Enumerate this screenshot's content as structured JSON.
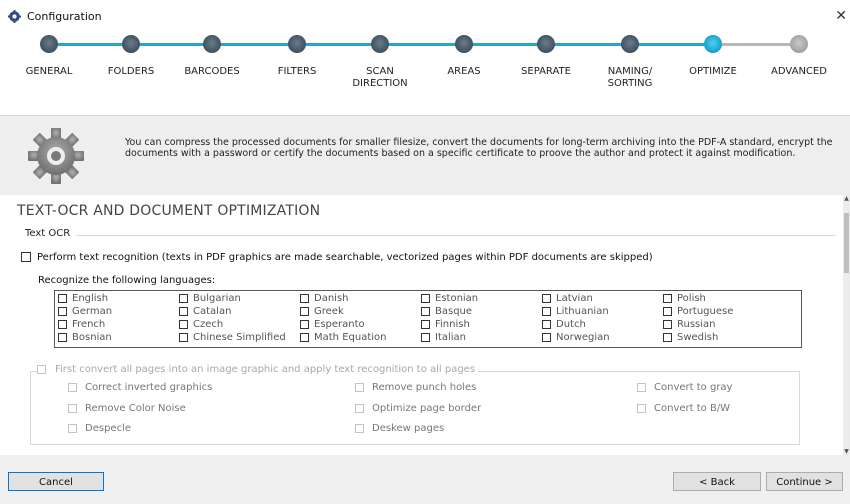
{
  "window": {
    "title": "Configuration",
    "close_label": "✕"
  },
  "steps": [
    {
      "label": "GENERAL",
      "state": "done"
    },
    {
      "label": "FOLDERS",
      "state": "done"
    },
    {
      "label": "BARCODES",
      "state": "done"
    },
    {
      "label": "FILTERS",
      "state": "done"
    },
    {
      "label": "SCAN\nDIRECTION",
      "state": "done"
    },
    {
      "label": "AREAS",
      "state": "done"
    },
    {
      "label": "SEPARATE",
      "state": "done"
    },
    {
      "label": "NAMING/\nSORTING",
      "state": "done"
    },
    {
      "label": "OPTIMIZE",
      "state": "current"
    },
    {
      "label": "ADVANCED",
      "state": "future"
    }
  ],
  "info": {
    "text": "You can compress the processed documents for smaller filesize, convert the documents for long-term archiving into the PDF-A standard, encrypt the documents with a password or certify the documents based on a specific certificate to proove the author and protect it against modification."
  },
  "section": {
    "title": "TEXT-OCR AND DOCUMENT OPTIMIZATION",
    "group_label": "Text OCR",
    "ocr_checkbox_label": "Perform text recognition (texts in PDF graphics are made searchable, vectorized pages within PDF documents are skipped)",
    "ocr_checked": false,
    "languages_label": "Recognize the following languages:",
    "languages": [
      "English",
      "Bulgarian",
      "Danish",
      "Estonian",
      "Latvian",
      "Polish",
      "German",
      "Catalan",
      "Greek",
      "Basque",
      "Lithuanian",
      "Portuguese",
      "French",
      "Czech",
      "Esperanto",
      "Finnish",
      "Dutch",
      "Russian",
      "Bosnian",
      "Chinese Simplified",
      "Math Equation",
      "Italian",
      "Norwegian",
      "Swedish"
    ],
    "image_convert_label": "First convert all pages into an image graphic and apply text recognition to all pages",
    "image_options": [
      "Correct inverted graphics",
      "Remove punch holes",
      "Convert to gray",
      "Remove Color Noise",
      "Optimize page border",
      "Convert to B/W",
      "Despecle",
      "Deskew pages"
    ]
  },
  "footer": {
    "cancel": "Cancel",
    "back": "< Back",
    "continue": "Continue >"
  },
  "colors": {
    "accent": "#2aa5c9",
    "current_step": "#1aa6d2",
    "done_step": "#47596a",
    "future_step": "#a6a6a6"
  }
}
